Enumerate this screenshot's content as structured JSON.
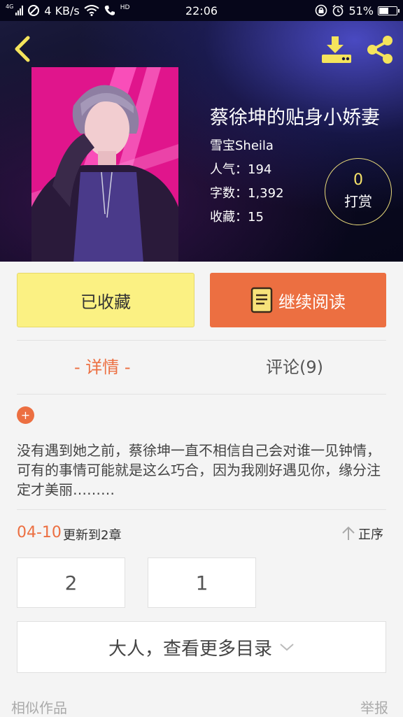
{
  "status_bar": {
    "network": "4G",
    "speed": "4 KB/s",
    "volte": "HD",
    "time": "22:06",
    "battery": "51%"
  },
  "book": {
    "title": "蔡徐坤的贴身小娇妻",
    "author": "雪宝Sheila",
    "popularity": "人气：194",
    "word_count": "字数：1,392",
    "favorites": "收藏：15",
    "tip_count": "0",
    "tip_label": "打赏"
  },
  "actions": {
    "favorited_label": "已收藏",
    "continue_reading_label": "继续阅读"
  },
  "tabs": {
    "detail": "- 详情 -",
    "comments": "评论(9)"
  },
  "synopsis": {
    "expand_icon": "+",
    "text": "没有遇到她之前，蔡徐坤一直不相信自己会对谁一见钟情，可有的事情可能就是这么巧合，因为我刚好遇见你，缘分注定才美丽………"
  },
  "update": {
    "date": "04-10",
    "text": "更新到2章",
    "order_label": "正序"
  },
  "chapters": [
    "2",
    "1"
  ],
  "more_catalog": "大人，查看更多目录",
  "footer": {
    "similar": "相似作品",
    "report": "举报"
  },
  "colors": {
    "accent": "#ec6f41",
    "favorite_button": "#fbf183",
    "tip_gold": "#f6e36a"
  }
}
